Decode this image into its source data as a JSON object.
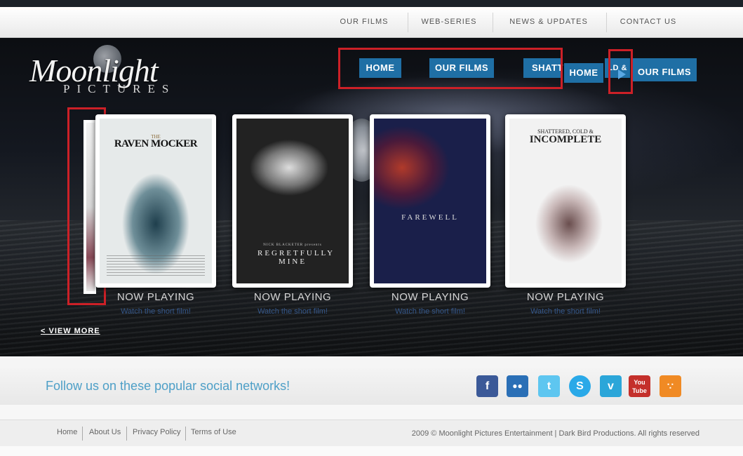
{
  "top_nav": {
    "items": [
      "OUR FILMS",
      "WEB-SERIES",
      "NEWS & UPDATES",
      "CONTACT US"
    ]
  },
  "logo": {
    "line1": "Moonlight",
    "line2": "PICTURES"
  },
  "overlay_nav": {
    "home_label": "HOME",
    "films_label": "OUR FILMS",
    "shattered_label": "SHATT",
    "home2_label": "HOME",
    "films2_label": "OUR FILMS",
    "partial_label": "LD &"
  },
  "films": [
    {
      "title_top": "THE",
      "title": "RAVEN MOCKER",
      "status": "NOW PLAYING",
      "link": "Watch the short film!"
    },
    {
      "title_top": "NICK BLACKETER presents",
      "title": "REGRETFULLY MINE",
      "status": "NOW PLAYING",
      "link": "Watch the short film!"
    },
    {
      "title_top": "",
      "title": "FAREWELL",
      "status": "NOW PLAYING",
      "link": "Watch the short film!"
    },
    {
      "title_top": "SHATTERED, COLD &",
      "title": "INCOMPLETE",
      "status": "NOW PLAYING",
      "link": "Watch the short film!"
    }
  ],
  "view_more": "< VIEW MORE",
  "social": {
    "heading": "Follow us on these popular social networks!",
    "icons": [
      "facebook-icon",
      "myspace-icon",
      "twitter-icon",
      "skype-icon",
      "vimeo-icon",
      "youtube-icon",
      "rss-icon"
    ],
    "icon_colors": {
      "facebook": "#3b5998",
      "myspace": "#2a6fb6",
      "twitter": "#5ec6f0",
      "skype": "#2aa9e8",
      "vimeo": "#2ba6d9",
      "youtube": "#c4302b",
      "rss": "#f08a24"
    }
  },
  "footer": {
    "links": [
      "Home",
      "About Us",
      "Privacy Policy",
      "Terms of Use"
    ],
    "copyright": "2009 © Moonlight Pictures Entertainment | Dark Bird Productions. All rights reserved"
  }
}
